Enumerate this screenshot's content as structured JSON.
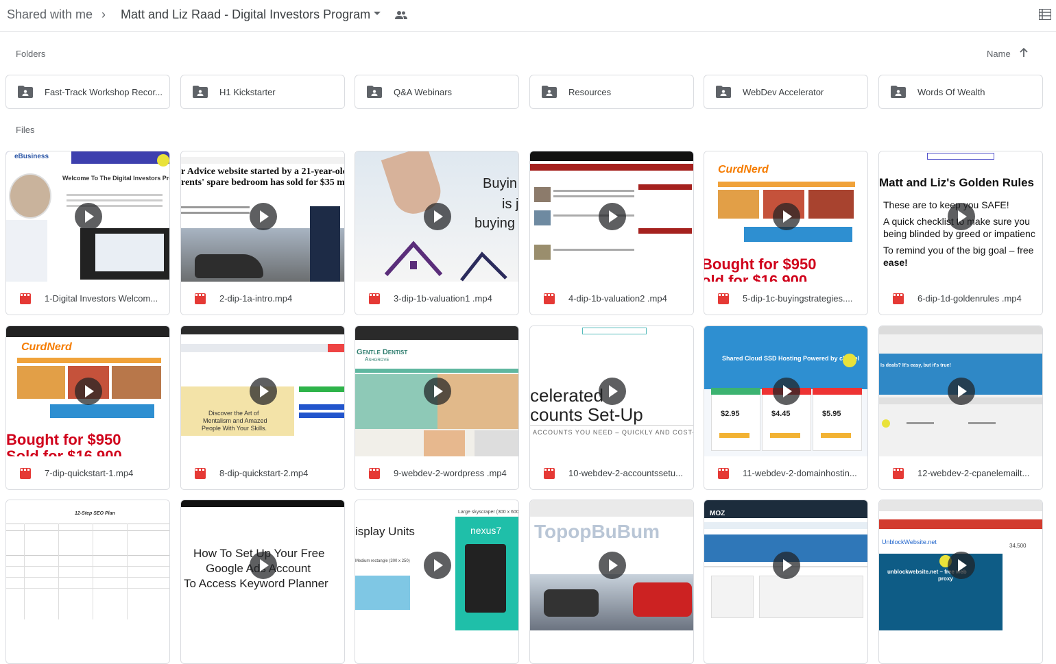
{
  "breadcrumb": {
    "root": "Shared with me",
    "separator": "›",
    "folder": "Matt and Liz Raad - Digital Investors Program"
  },
  "sections": {
    "folders_label": "Folders",
    "files_label": "Files",
    "sort_label": "Name"
  },
  "folders": [
    "Fast-Track Workshop Recor...",
    "H1 Kickstarter",
    "Q&A Webinars",
    "Resources",
    "WebDev Accelerator",
    "Words Of Wealth"
  ],
  "files": [
    "1-Digital Investors Welcom...",
    "2-dip-1a-intro.mp4",
    "3-dip-1b-valuation1 .mp4",
    "4-dip-1b-valuation2 .mp4",
    "5-dip-1c-buyingstrategies....",
    "6-dip-1d-goldenrules .mp4",
    "7-dip-quickstart-1.mp4",
    "8-dip-quickstart-2.mp4",
    "9-webdev-2-wordpress .mp4",
    "10-webdev-2-accountssetu...",
    "11-webdev-2-domainhostin...",
    "12-webdev-2-cpanelemailt..."
  ],
  "thumb_text": {
    "t1_title": "Welcome To The Digital Investors Pro",
    "t1_brand": "eBusiness",
    "t2_headline1": "r Advice website started by a 21-year-old",
    "t2_headline2": "rents' spare bedroom has sold for $35 mil",
    "t3_line1": "Buyin",
    "t3_line2": "is j",
    "t3_line3": "buying",
    "t5_line1": "Bought for $950",
    "t5_line2": "old for $16,900",
    "t5_logo": "CurdNerd",
    "t6_title": "Matt and Liz's Golden Rules",
    "t6_l1": "These are to keep you SAFE!",
    "t6_l2": "A quick checklist to make sure you",
    "t6_l3": "being blinded by greed or impatienc",
    "t6_l4": "To remind you of the big goal – free",
    "t6_l5": "ease!",
    "t7_line1": "Bought for $950",
    "t7_line2": "Sold for $16,900",
    "t7_logo": "CurdNerd",
    "t8_l1": "Discover the Art of",
    "t8_l2": "Mentalism and Amazed",
    "t8_l3": "People With Your Skills.",
    "t9_brand": "Gentle Dentist",
    "t9_sub": "Ashgrove",
    "t10_l1": "celerated",
    "t10_l2": "counts Set-Up",
    "t10_l3": "ACCOUNTS YOU NEED – QUICKLY AND COST-EFFE",
    "t11_title": "Shared Cloud SSD Hosting Powered by cPanel",
    "t11_p1": "$2.95",
    "t11_p2": "$4.45",
    "t11_p3": "$5.95",
    "t12_title": "Is deals? It's easy, but it's true!",
    "t13_title": "12-Step SEO Plan",
    "t14_l1": "How To Set Up Your Free",
    "t14_l2": "Google Ads Account",
    "t14_l3": "To Access Keyword Planner",
    "t15_l1": "isplay Units",
    "t15_l2": "Large skyscraper (300 x 600)",
    "t15_l3": "Medium rectangle (300 x 250)",
    "t15_l4": "nexus7",
    "t16_title": "TopopBuBum",
    "t17_brand": "MOZ",
    "t18_title": "UnblockWebsite.net",
    "t18_l2": "unblockwebsite.net – free web",
    "t18_l3": "proxy",
    "t18_price": "34,500"
  },
  "colors": {
    "border": "#dadce0",
    "text": "#3c4043",
    "muted": "#5f6368",
    "video_icon": "#e53935",
    "folder_icon": "#5f6368"
  }
}
